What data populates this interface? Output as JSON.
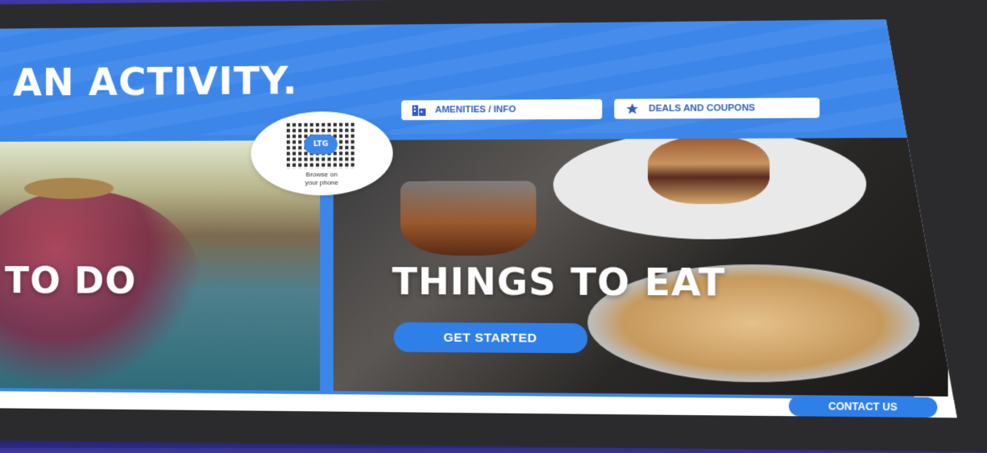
{
  "banner": {
    "title": "D AN ACTIVITY."
  },
  "quick_links": {
    "amenities_label": "AMENITIES / INFO",
    "amenities_icon": "building-icon",
    "deals_label": "DEALS AND COUPONS",
    "deals_icon": "star-icon"
  },
  "qr": {
    "logo_text": "LTG",
    "caption_line1": "Browse on",
    "caption_line2": "your phone"
  },
  "panels": {
    "left": {
      "title": "GS TO DO",
      "cta_label": ""
    },
    "right": {
      "title": "THINGS TO EAT",
      "cta_label": "GET STARTED"
    }
  },
  "footer": {
    "contact_label": "CONTACT US"
  },
  "colors": {
    "background": "#4a44c8",
    "banner_blue": "#3c86ea",
    "button_blue": "#2f7fe8",
    "bezel": "#2b2b2e"
  }
}
